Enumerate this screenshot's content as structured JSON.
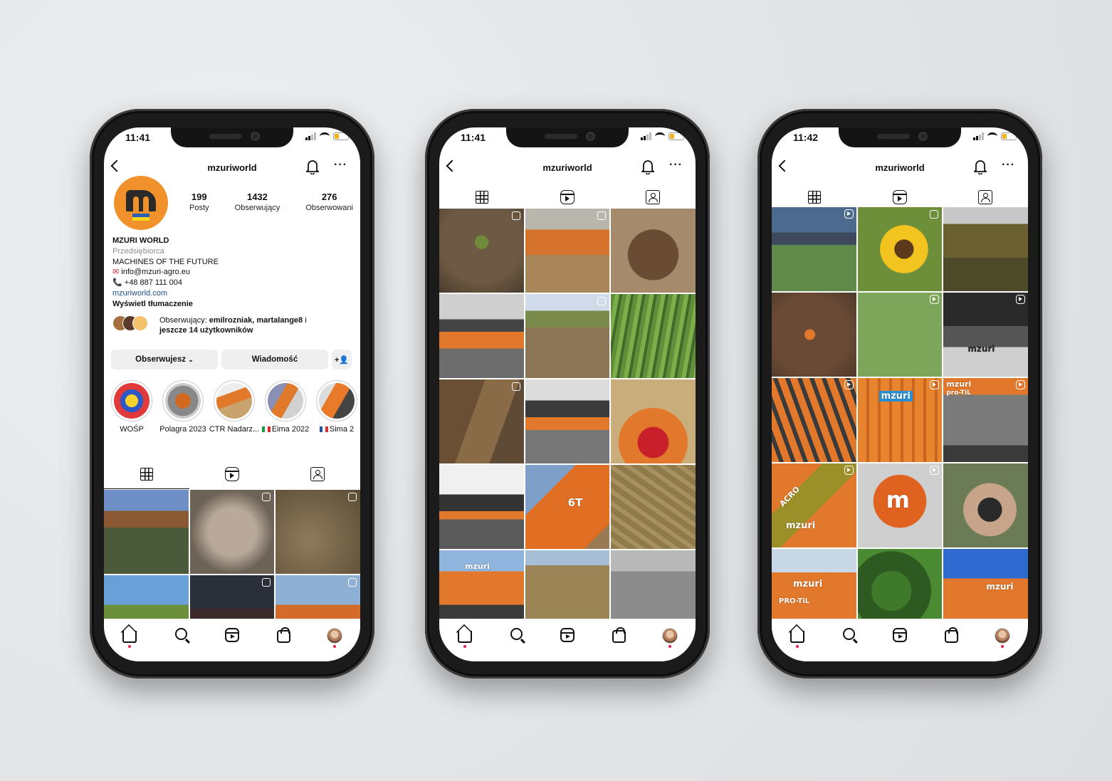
{
  "background_color": "#e4e6e8",
  "accent_orange": "#f1912c",
  "phones": [
    {
      "time": "11:41",
      "username": "mzuriworld",
      "profile": {
        "stats": [
          {
            "value": "199",
            "label": "Posty"
          },
          {
            "value": "1432",
            "label": "Obserwujący"
          },
          {
            "value": "276",
            "label": "Obserwowani"
          }
        ],
        "name": "MZURI WORLD",
        "category": "Przedsiębiorca",
        "tagline": "MACHINES OF THE FUTURE",
        "email": "info@mzuri-agro.eu",
        "phone": "+48 887 111 004",
        "link": "mzuriworld.com",
        "translate": "Wyświetl tłumaczenie",
        "followed_prefix": "Obserwujący: ",
        "followed_names": "emilrozniak, martalange8",
        "followed_mid": " i ",
        "followed_more": "jeszcze 14 użytkowników",
        "btn_follow": "Obserwujesz",
        "btn_message": "Wiadomość",
        "highlights": [
          {
            "label": "WOŚP"
          },
          {
            "label": "Polagra 2023"
          },
          {
            "label": "CTR Nadarz..."
          },
          {
            "label": "Eima 2022"
          },
          {
            "label": "Sima 2"
          }
        ]
      }
    },
    {
      "time": "11:41",
      "username": "mzuriworld"
    },
    {
      "time": "11:42",
      "username": "mzuriworld"
    }
  ],
  "icons": [
    "back-arrow-icon",
    "bell-icon",
    "more-icon",
    "grid-icon",
    "reels-icon",
    "tagged-icon",
    "home-icon",
    "search-icon",
    "shop-icon"
  ]
}
